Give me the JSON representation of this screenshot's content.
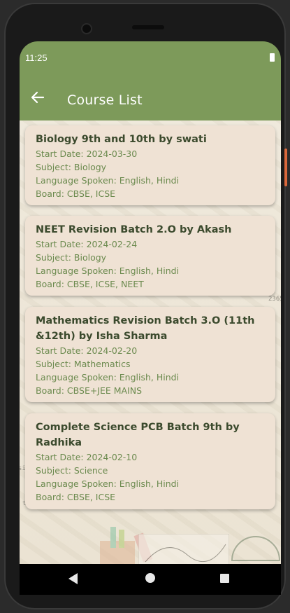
{
  "status_bar": {
    "time": "11:25",
    "battery_icon": "battery-full-icon"
  },
  "app_bar": {
    "title": "Course List",
    "back_icon": "arrow-back-icon"
  },
  "colors": {
    "appbar": "#7d9a5a",
    "card": "#efe2d4",
    "title_text": "#3b4a2d",
    "detail_text": "#6b8a4e"
  },
  "courses": [
    {
      "title": "Biology 9th and 10th by swati",
      "start_date": "Start Date: 2024-03-30",
      "subject": "Subject: Biology",
      "language": "Language Spoken: English, Hindi",
      "board": "Board: CBSE, ICSE"
    },
    {
      "title": "NEET Revision Batch  2.O by Akash",
      "start_date": "Start Date: 2024-02-24",
      "subject": "Subject: Biology",
      "language": "Language Spoken: English, Hindi",
      "board": "Board: CBSE, ICSE, NEET"
    },
    {
      "title": "Mathematics Revision  Batch 3.O (11th &12th) by Isha Sharma",
      "start_date": "Start Date: 2024-02-20",
      "subject": "Subject: Mathematics",
      "language": "Language Spoken: English, Hindi",
      "board": "Board: CBSE+JEE MAINS"
    },
    {
      "title": "Complete Science PCB Batch 9th  by Radhika",
      "start_date": "Start Date: 2024-02-10",
      "subject": "Subject: Science",
      "language": "Language Spoken: English, Hindi",
      "board": "Board: CBSE, ICSE"
    }
  ],
  "nav_bar": {
    "back": "nav-back-icon",
    "home": "nav-home-icon",
    "recents": "nav-recents-icon"
  }
}
